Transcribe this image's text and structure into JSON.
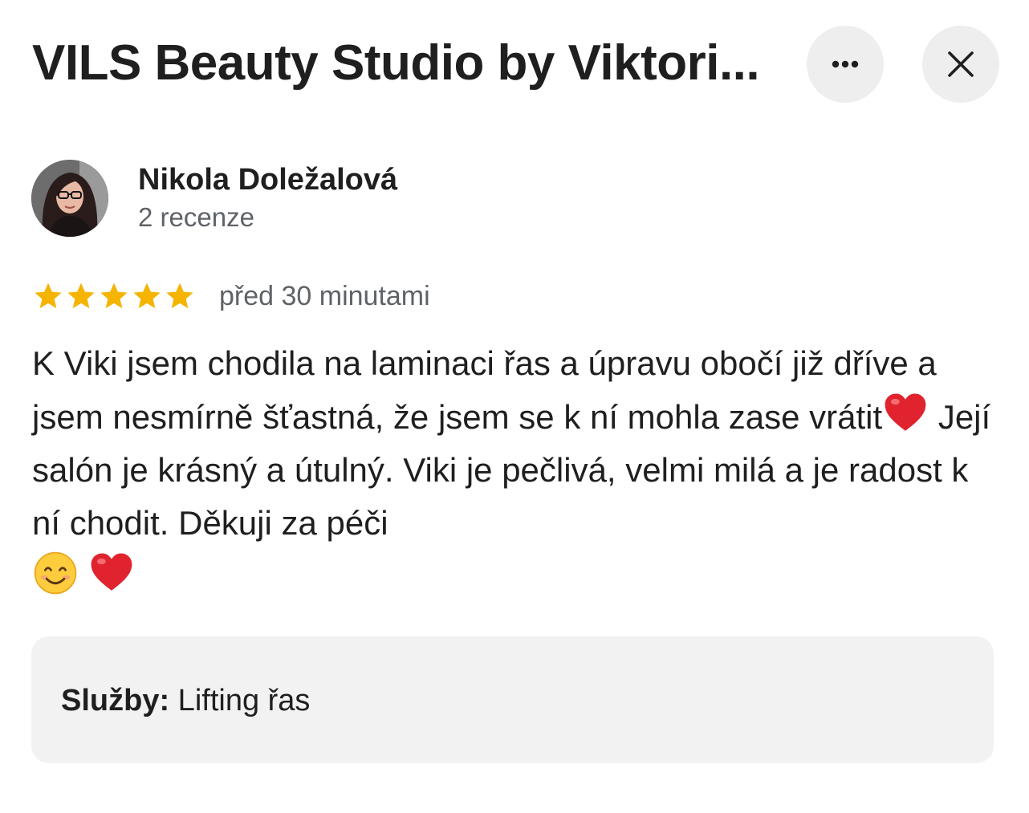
{
  "header": {
    "title": "VILS Beauty Studio by Viktori...",
    "more_icon": "more-horizontal-icon",
    "close_icon": "close-icon"
  },
  "review": {
    "author_name": "Nikola Doležalová",
    "author_reviews": "2 recenze",
    "rating": 5,
    "rating_max": 5,
    "time": "před 30 minutami",
    "text_parts": {
      "part1": "K Viki jsem chodila na laminaci řas a úpravu obočí již dříve a jsem nesmírně šťastná, že jsem se k ní mohla zase vrátit",
      "part2": " Její salón je krásný a útulný. Viki je pečlivá, velmi milá a je radost k ní chodit. Děkuji za péči "
    },
    "emojis": [
      "red-heart-emoji",
      "smiling-face-emoji",
      "red-heart-emoji"
    ]
  },
  "services": {
    "label": "Služby:",
    "value": " Lifting řas"
  },
  "colors": {
    "star": "#f4b400",
    "button_bg": "#eeeeee",
    "services_bg": "#f2f2f2",
    "secondary_text": "#5f6368",
    "heart": "#e0232e"
  }
}
